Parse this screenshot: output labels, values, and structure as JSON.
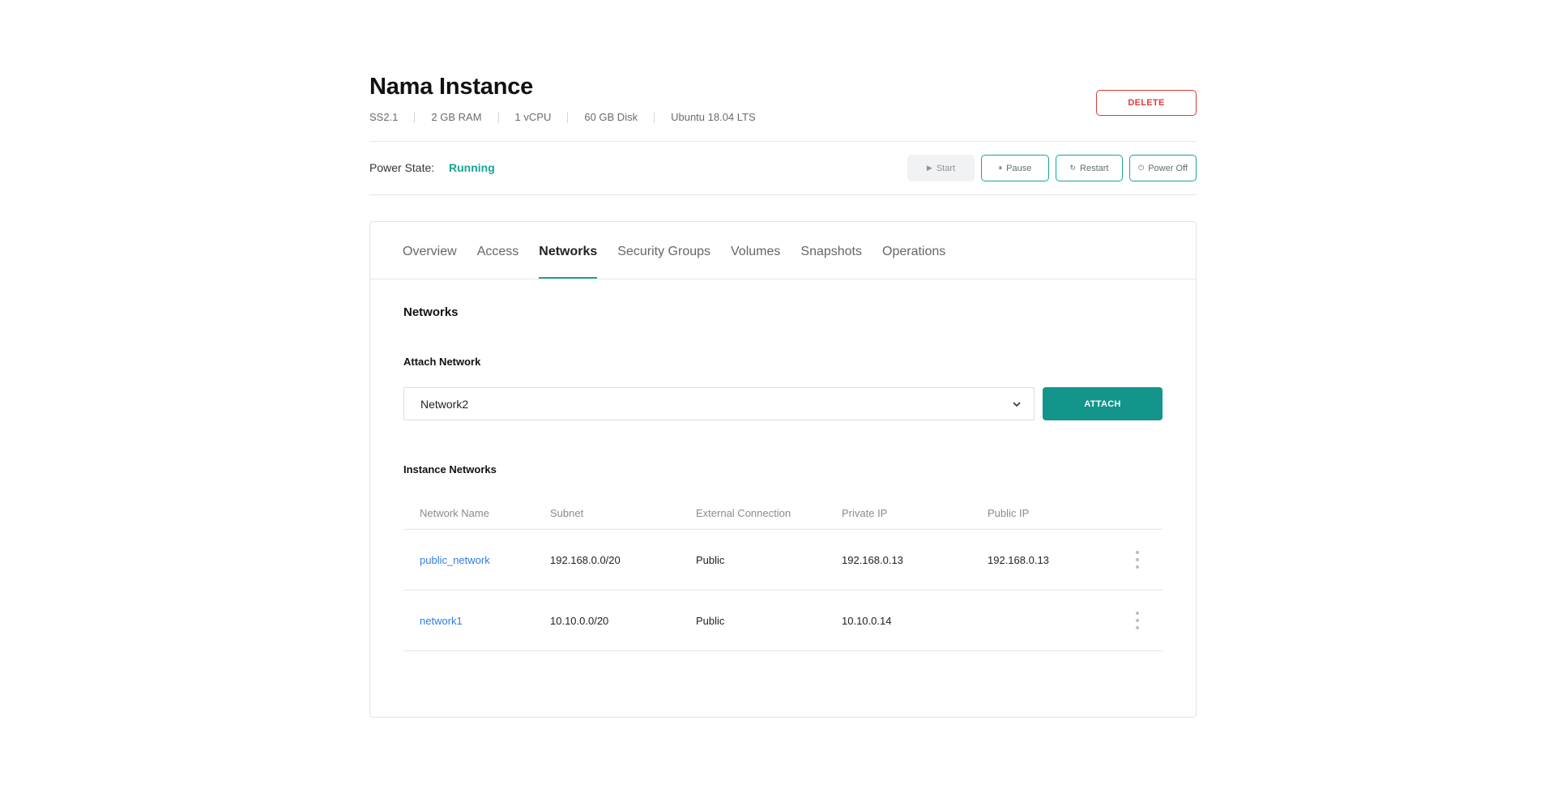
{
  "instance": {
    "title": "Nama Instance",
    "specs": [
      "SS2.1",
      "2 GB RAM",
      "1 vCPU",
      "60 GB Disk",
      "Ubuntu 18.04 LTS"
    ],
    "delete_label": "DELETE"
  },
  "power": {
    "label": "Power State:",
    "state": "Running",
    "buttons": {
      "start": "Start",
      "pause": "Pause",
      "restart": "Restart",
      "power_off": "Power Off"
    }
  },
  "tabs": [
    "Overview",
    "Access",
    "Networks",
    "Security Groups",
    "Volumes",
    "Snapshots",
    "Operations"
  ],
  "active_tab": "Networks",
  "networks": {
    "section_title": "Networks",
    "attach_label": "Attach Network",
    "selected_network": "Network2",
    "attach_button": "ATTACH",
    "instance_networks_label": "Instance Networks",
    "columns": [
      "Network Name",
      "Subnet",
      "External Connection",
      "Private IP",
      "Public IP"
    ],
    "rows": [
      {
        "name": "public_network",
        "subnet": "192.168.0.0/20",
        "external": "Public",
        "private_ip": "192.168.0.13",
        "public_ip": "192.168.0.13"
      },
      {
        "name": "network1",
        "subnet": "10.10.0.0/20",
        "external": "Public",
        "private_ip": "10.10.0.14",
        "public_ip": ""
      }
    ]
  },
  "colors": {
    "accent": "#17a398",
    "danger": "#e03a3a",
    "link": "#2f7de1"
  }
}
